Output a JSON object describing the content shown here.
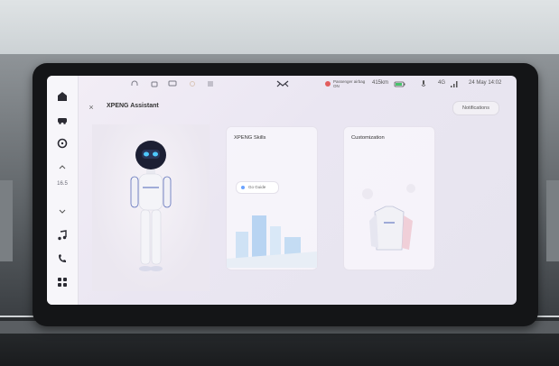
{
  "status_bar": {
    "seatbelt": "Passenger airbag ON",
    "range": "415km",
    "signal": "4G",
    "datetime": "24 May 14:02"
  },
  "header": {
    "title": "XPENG Assistant",
    "notifications_label": "Notifications"
  },
  "dock": {
    "temperature": "16.5"
  },
  "cards": [
    {
      "title": "XPENG Skills",
      "pill": "Go Guide"
    },
    {
      "title": "Customization"
    }
  ],
  "icons": [
    "home-icon",
    "car-icon",
    "steering-icon",
    "chevron-up-icon",
    "chevron-down-icon",
    "music-icon",
    "phone-icon",
    "apps-icon",
    "logo-icon",
    "battery-icon"
  ]
}
